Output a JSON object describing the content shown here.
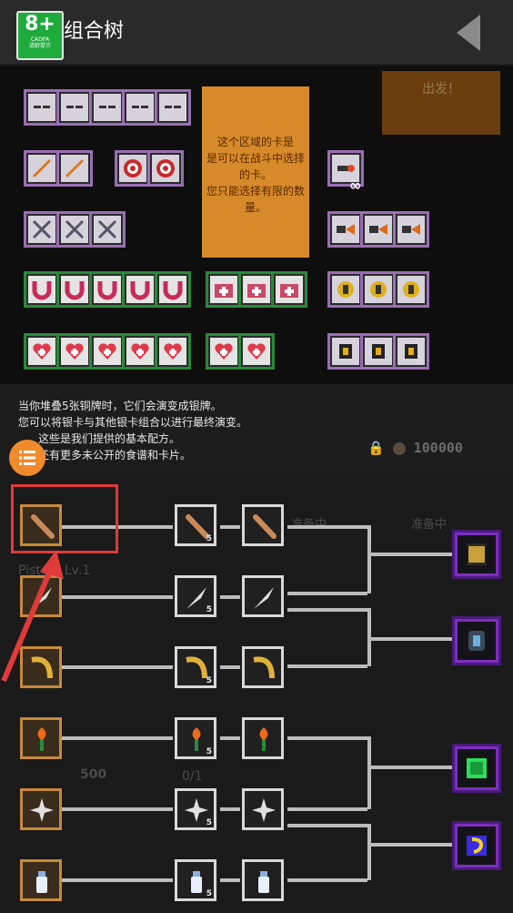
{
  "header": {
    "title": "组合树",
    "age_rating": "8+",
    "age_rating_sub1": "CADPA",
    "age_rating_sub2": "适龄提示"
  },
  "info_box": {
    "lines": [
      "这个区域的卡是",
      "是可以在战斗中选择",
      "的卡。",
      "您只能选择有限的数",
      "量。"
    ]
  },
  "top_right_tag": "出发！",
  "infinity": "∞",
  "instructions": {
    "line1": "当你堆叠5张铜牌时，它们会演变成银牌。",
    "line2": "您可以将银卡与其他银卡组合以进行最终演变。",
    "line3": "这些是我们提供的基本配方。",
    "line4": "还有更多未公开的食谱和卡片。"
  },
  "lock_value": "100000",
  "background_ghost": {
    "level": "Pistol / Lv.1",
    "ready1": "准备中...",
    "ready2": "准备中",
    "cost": "500",
    "progress": "0/1"
  },
  "tree": {
    "rows": [
      {
        "name": "bat",
        "icon": "bat-icon",
        "count": "5"
      },
      {
        "name": "knife",
        "icon": "knife-icon",
        "count": "5"
      },
      {
        "name": "boomerang",
        "icon": "boomerang-icon",
        "count": "5"
      },
      {
        "name": "torch",
        "icon": "torch-icon",
        "count": "5"
      },
      {
        "name": "shuriken",
        "icon": "shuriken-icon",
        "count": "5"
      },
      {
        "name": "milk",
        "icon": "milk-bottle-icon",
        "count": "5"
      }
    ],
    "results": [
      "scroll-icon",
      "armor-icon",
      "green-crystal-icon",
      "rainbow-card-icon"
    ]
  },
  "colors": {
    "bronze_border": "#c9893a",
    "silver_border": "#d9d9d9",
    "purple_border": "#7b2fbf",
    "highlight": "#e03a3a",
    "info_box": "#d68a2a",
    "menu_button": "#f08a2a"
  }
}
